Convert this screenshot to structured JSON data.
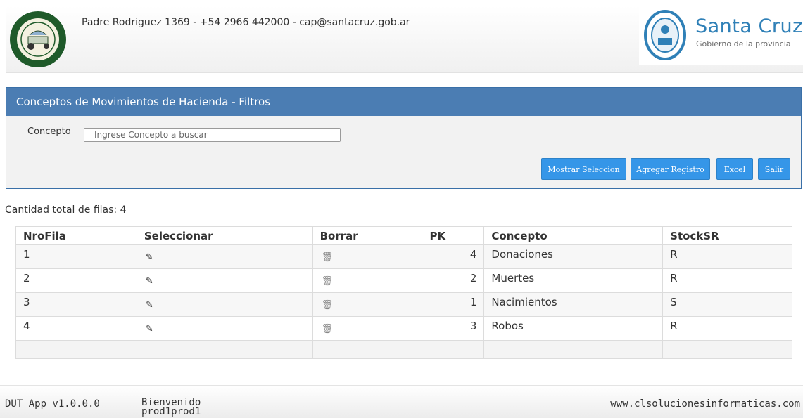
{
  "header": {
    "contact": "Padre Rodriguez 1369 - +54 2966 442000 - cap@santacruz.gob.ar",
    "brand_name": "Santa Cruz",
    "brand_sub": "Gobierno de la provincia"
  },
  "panel": {
    "title": "Conceptos de Movimientos de Hacienda - Filtros",
    "concept_label": "Concepto",
    "concept_placeholder": "Ingrese Concepto a buscar",
    "buttons": {
      "mostrar": "Mostrar Seleccion",
      "agregar": "Agregar Registro",
      "excel": "Excel",
      "salir": "Salir"
    }
  },
  "total_rows": "Cantidad total de filas: 4",
  "table": {
    "headers": [
      "NroFila",
      "Seleccionar",
      "Borrar",
      "PK",
      "Concepto",
      "StockSR"
    ],
    "rows": [
      {
        "nro": "1",
        "pk": "4",
        "concepto": "Donaciones",
        "stock": "R"
      },
      {
        "nro": "2",
        "pk": "2",
        "concepto": "Muertes",
        "stock": "R"
      },
      {
        "nro": "3",
        "pk": "1",
        "concepto": "Nacimientos",
        "stock": "S"
      },
      {
        "nro": "4",
        "pk": "3",
        "concepto": "Robos",
        "stock": "R"
      }
    ],
    "select_icon": "edit-icon",
    "delete_icon": "trash-icon"
  },
  "footer": {
    "version": "DUT App v1.0.0.0",
    "welcome": "Bienvenido",
    "user": "prod1prod1",
    "site": "www.clsolucionesinformaticas.com"
  },
  "colors": {
    "panel_header": "#4b7db3",
    "button": "#3596e8",
    "brand": "#2f80b7"
  }
}
